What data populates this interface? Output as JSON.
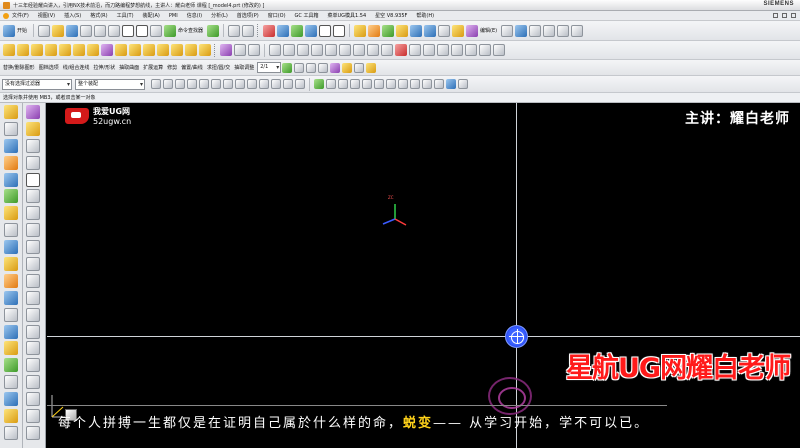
{
  "window": {
    "title": "十三年经验耀白讲入，引用NX技术前沿，而刀路编程梦想航线，主讲人：耀白老师   课程   [_model4.prt (修改的) ]",
    "brand": "SIEMENS"
  },
  "menu": {
    "items": [
      "文件(F)",
      "视图(V)",
      "插入(S)",
      "格式(R)",
      "工具(T)",
      "装配(A)",
      "PMI",
      "信息(I)",
      "分析(L)",
      "首选项(P)",
      "窗口(O)",
      "GC 工具箱",
      "菜单UG模具1.54",
      "星空 V8.935F",
      "帮助(H)"
    ]
  },
  "toolbar1": {
    "start_label": "开始",
    "view_label": "命令查找器",
    "edit_label": "编辑(E)"
  },
  "toolbar3": {
    "labels": [
      "替换/删除图形",
      "图档选项",
      "线/组合连线",
      "拉伸/形状",
      "抽取曲面",
      "扩展运算",
      "修剪",
      "偏置/曲线",
      "求扭/圆/交",
      "抽取调整"
    ],
    "combo_value": "2/1"
  },
  "toolbar4": {
    "selection_filter": "没有选择过滤器",
    "assembly_scope": "整个装配"
  },
  "status": {
    "prompt": "选择对象并使用 MB3，或者双击某一对象"
  },
  "watermark": {
    "site_name": "我爱UG网",
    "site_url": "52ugw.cn",
    "lecturer": "主讲：耀白老师",
    "channel": "星航UG网耀白老师"
  },
  "subtitle": {
    "before": "每个人拼搏一生都仅是在证明自己属於什么样的命，",
    "highlight": "蜕变",
    "after": "—— 从学习开始，学不可以已。"
  },
  "triad_label": "ZC",
  "colors": {
    "viewport_bg": "#000000",
    "snap_marker": "#2a4bff",
    "channel_text": "#ff1a1a",
    "highlight_text": "#ffd21a"
  }
}
